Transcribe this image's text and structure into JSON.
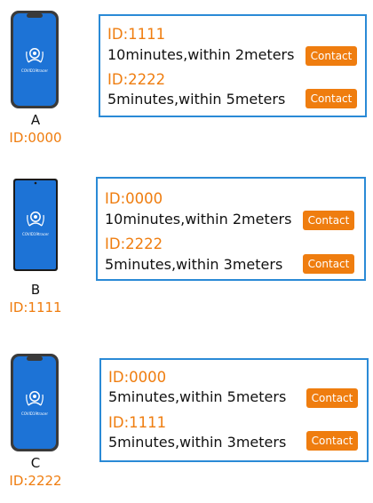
{
  "app_logo_label": "COVID19tracer",
  "colors": {
    "accent_orange": "#ef7d0f",
    "card_border_blue": "#2a8ad6",
    "phone_screen_blue": "#1d73d6"
  },
  "users": [
    {
      "name": "A",
      "id": "ID:0000",
      "contacts": [
        {
          "id": "ID:1111",
          "desc": "10minutes,within 2meters",
          "button": "Contact"
        },
        {
          "id": "ID:2222",
          "desc": "5minutes,within 5meters",
          "button": "Contact"
        }
      ]
    },
    {
      "name": "B",
      "id": "ID:1111",
      "contacts": [
        {
          "id": "ID:0000",
          "desc": "10minutes,within 2meters",
          "button": "Contact"
        },
        {
          "id": "ID:2222",
          "desc": "5minutes,within 3meters",
          "button": "Contact"
        }
      ]
    },
    {
      "name": "C",
      "id": "ID:2222",
      "contacts": [
        {
          "id": "ID:0000",
          "desc": "5minutes,within 5meters",
          "button": "Contact"
        },
        {
          "id": "ID:1111",
          "desc": "5minutes,within 3meters",
          "button": "Contact"
        }
      ]
    }
  ]
}
